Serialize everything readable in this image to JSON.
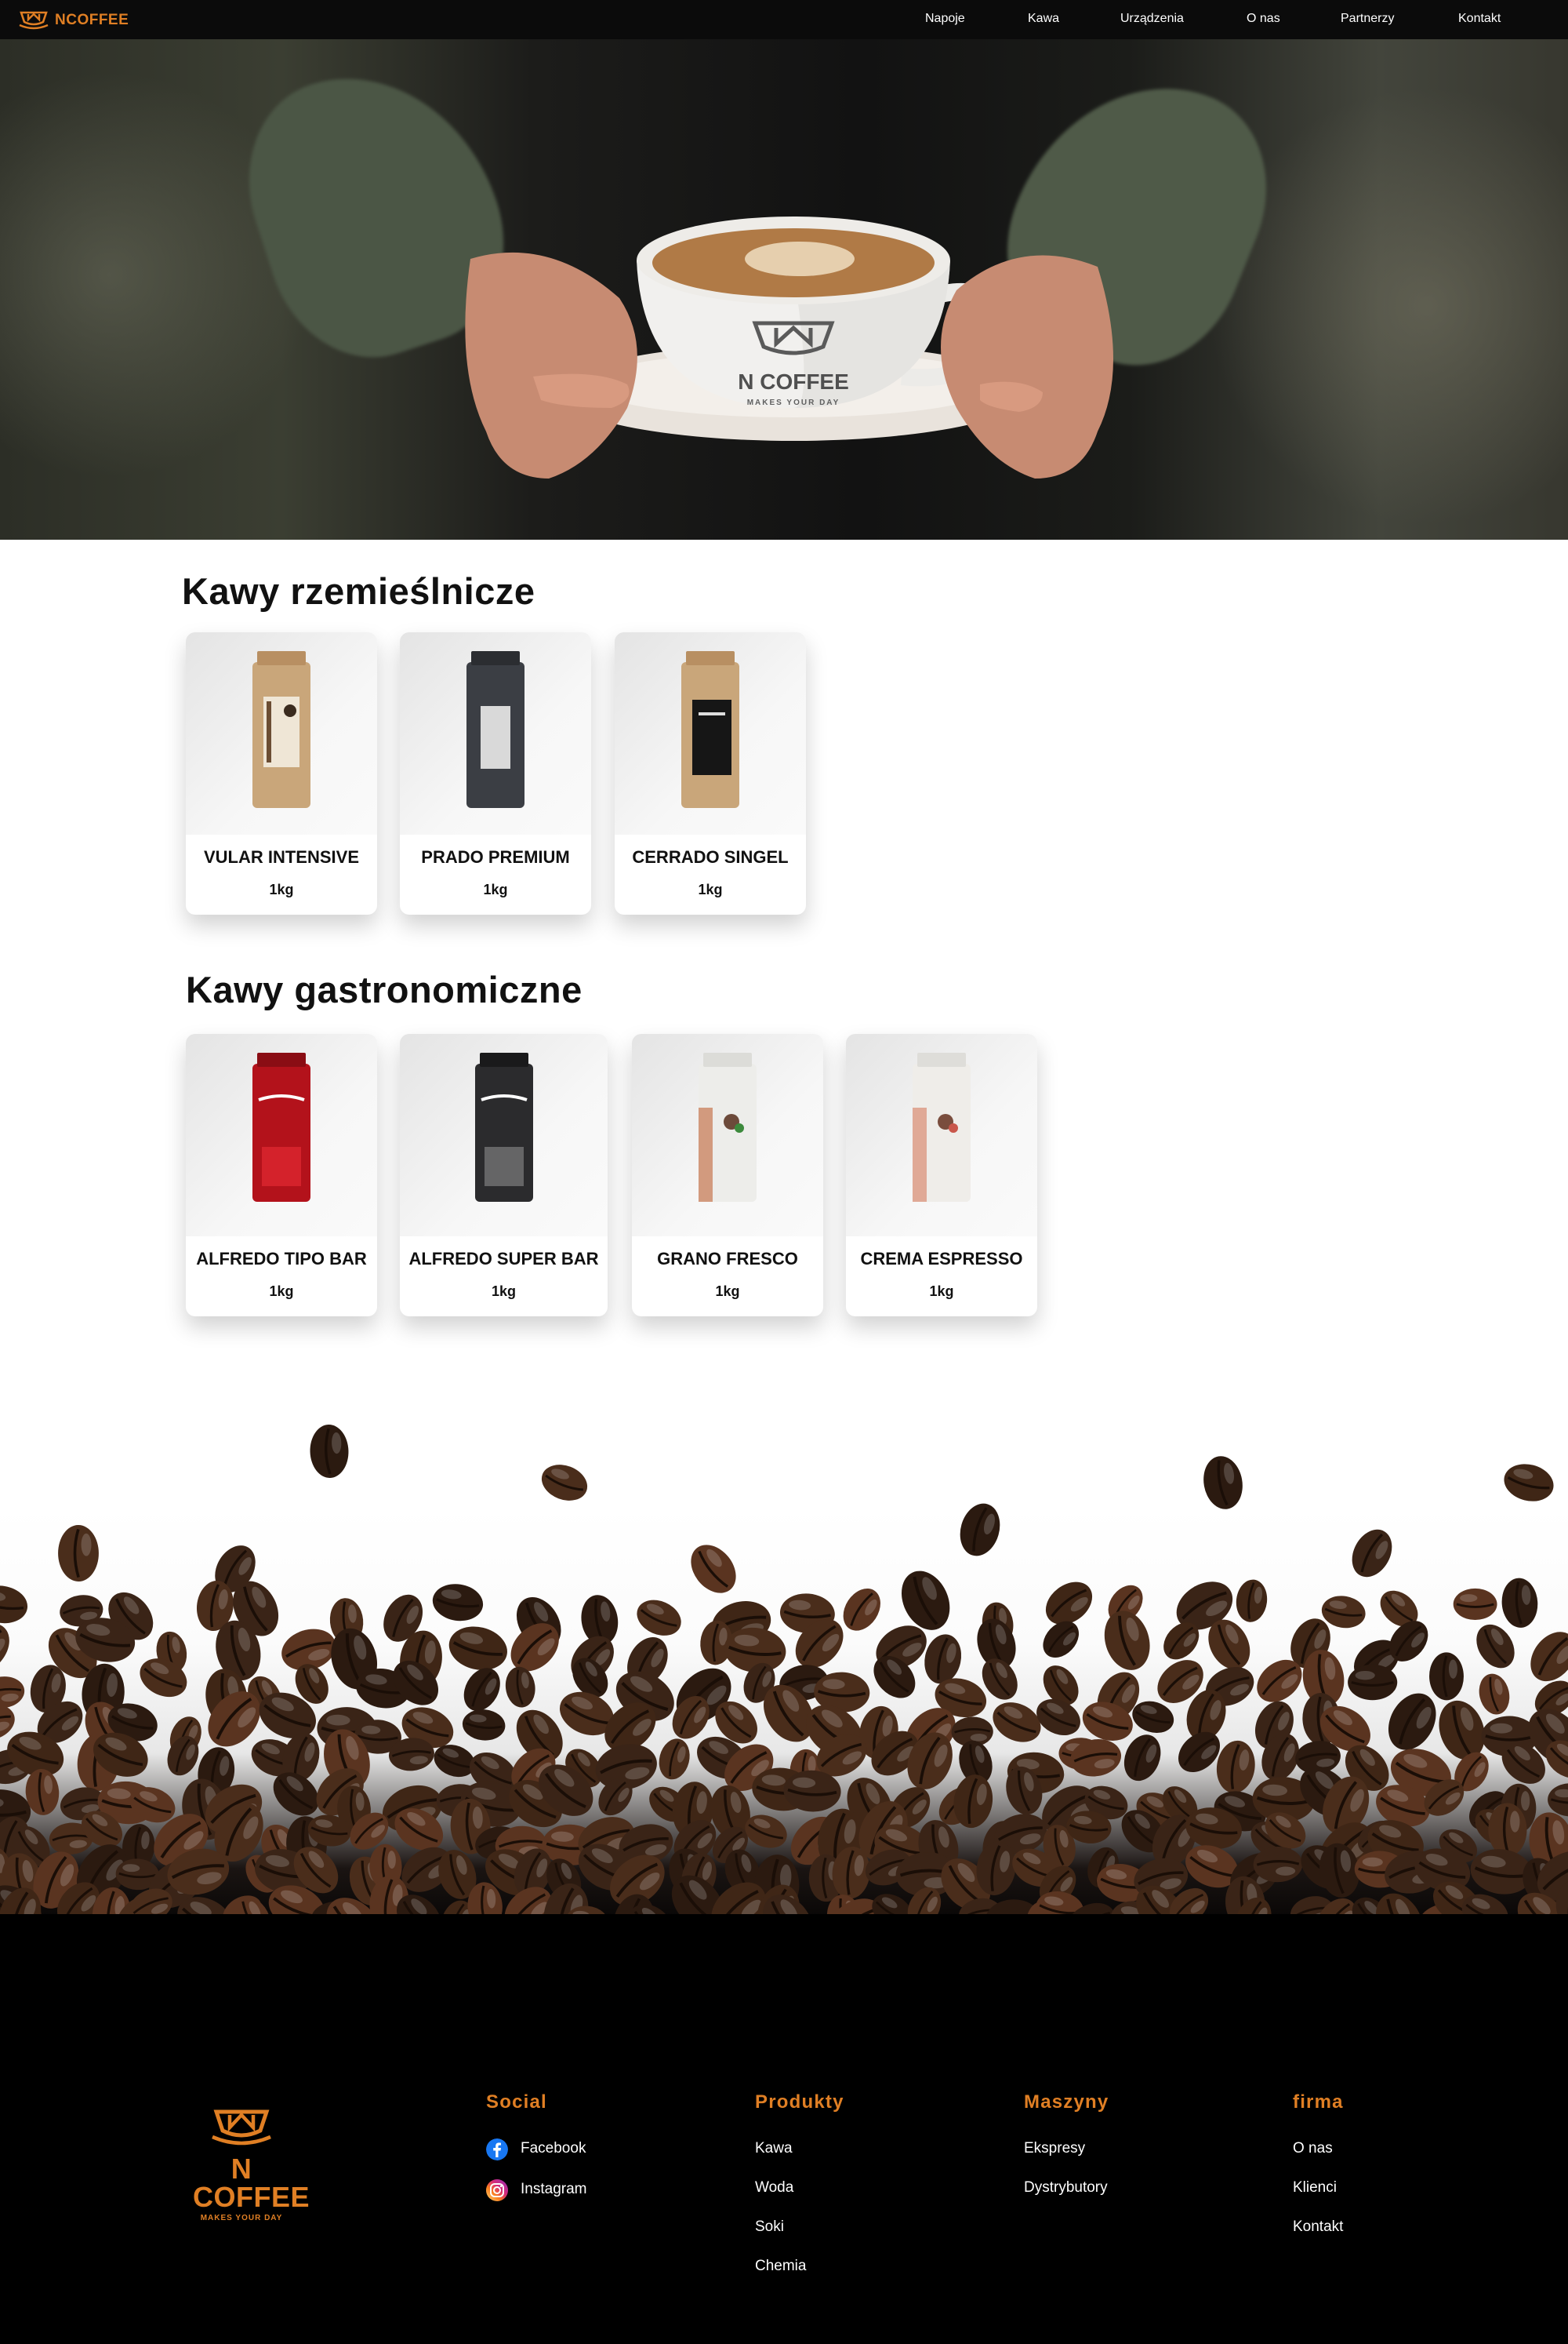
{
  "nav": {
    "brand": "NCOFFEE",
    "links": [
      "Napoje",
      "Kawa",
      "Urządzenia",
      "O nas",
      "Partnerzy",
      "Kontakt"
    ]
  },
  "hero": {
    "cup_brand": "N COFFEE",
    "cup_tagline": "MAKES YOUR DAY"
  },
  "craft": {
    "title": "Kawy rzemieślnicze",
    "products": [
      {
        "name": "VULAR INTENSIVE",
        "weight": "1kg"
      },
      {
        "name": "PRADO PREMIUM",
        "weight": "1kg"
      },
      {
        "name": "CERRADO SINGEL",
        "weight": "1kg"
      }
    ]
  },
  "gastro": {
    "title": "Kawy gastronomiczne",
    "products": [
      {
        "name": "ALFREDO TIPO BAR",
        "weight": "1kg"
      },
      {
        "name": "ALFREDO SUPER BAR",
        "weight": "1kg"
      },
      {
        "name": "GRANO FRESCO",
        "weight": "1kg"
      },
      {
        "name": "CREMA ESPRESSO",
        "weight": "1kg"
      }
    ]
  },
  "footer": {
    "logo_text": "N COFFEE",
    "logo_tagline": "MAKES YOUR DAY",
    "social": {
      "heading": "Social",
      "facebook": "Facebook",
      "instagram": "Instagram"
    },
    "produkty": {
      "heading": "Produkty",
      "links": [
        "Kawa",
        "Woda",
        "Soki",
        "Chemia"
      ]
    },
    "maszyny": {
      "heading": "Maszyny",
      "links": [
        "Ekspresy",
        "Dystrybutory"
      ]
    },
    "firma": {
      "heading": "firma",
      "links": [
        "O nas",
        "Klienci",
        "Kontakt"
      ]
    }
  },
  "colors": {
    "accent": "#e07f24",
    "nav_bg": "#0b0b0b",
    "footer_bg": "#000000"
  }
}
